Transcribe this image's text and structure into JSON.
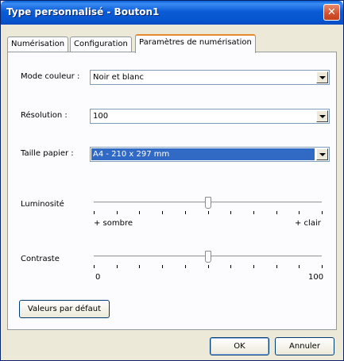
{
  "window": {
    "title": "Type personnalisé - Bouton1",
    "close_label": "✕"
  },
  "tabs": [
    {
      "label": "Numérisation"
    },
    {
      "label": "Configuration"
    },
    {
      "label": "Paramètres de numérisation"
    }
  ],
  "settings": {
    "mode_label": "Mode couleur :",
    "mode_value": "Noir et blanc",
    "resolution_label": "Résolution :",
    "resolution_value": "100",
    "paper_label": "Taille papier :",
    "paper_value": "A4 - 210 x 297 mm"
  },
  "brightness": {
    "label": "Luminosité",
    "min_label": "+ sombre",
    "max_label": "+ clair",
    "position_fraction": 0.5
  },
  "contrast": {
    "label": "Contraste",
    "min_label": "0",
    "max_label": "100",
    "position_fraction": 0.5
  },
  "buttons": {
    "defaults_label": "Valeurs par défaut",
    "ok_label": "OK",
    "cancel_label": "Annuler"
  }
}
